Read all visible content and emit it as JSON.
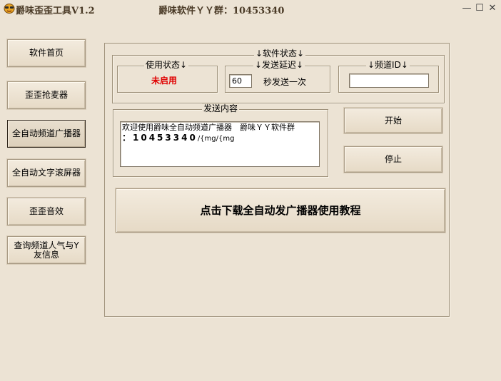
{
  "window": {
    "title": "爵味歪歪工具V1.2",
    "subtitle": "爵味软件ＹＹ群：10453340",
    "minimize_glyph": "—",
    "maximize_glyph": "☐",
    "close_glyph": "✕"
  },
  "sidebar": {
    "items": [
      {
        "label": "软件首页"
      },
      {
        "label": "歪歪抢麦器"
      },
      {
        "label": "全自动频道广播器"
      },
      {
        "label": "全自动文字滚屏器"
      },
      {
        "label": "歪歪音效"
      },
      {
        "label": "查询频道人气与Y友信息"
      }
    ]
  },
  "status_group": {
    "title": "↓软件状态↓",
    "usage": {
      "title": "使用状态↓",
      "value": "未启用",
      "value_color": "#e00000"
    },
    "delay": {
      "title": "↓发送延迟↓",
      "value": "60",
      "suffix": "秒发送一次"
    },
    "channel": {
      "title": "↓频道ID↓",
      "value": ""
    }
  },
  "content_group": {
    "title": "发送内容",
    "text_line1": "欢迎使用爵味全自动频道广播器　爵味ＹＹ软件群",
    "text_line2_prefix": "：10453340",
    "text_line2_suffix": "/{mg/{mg"
  },
  "actions": {
    "start_label": "开始",
    "stop_label": "停止",
    "download_label": "点击下载全自动发广播器使用教程"
  },
  "icons": {
    "app": "cartoon-face-icon",
    "minimize": "minimize-icon",
    "maximize": "maximize-icon",
    "close": "close-icon"
  }
}
